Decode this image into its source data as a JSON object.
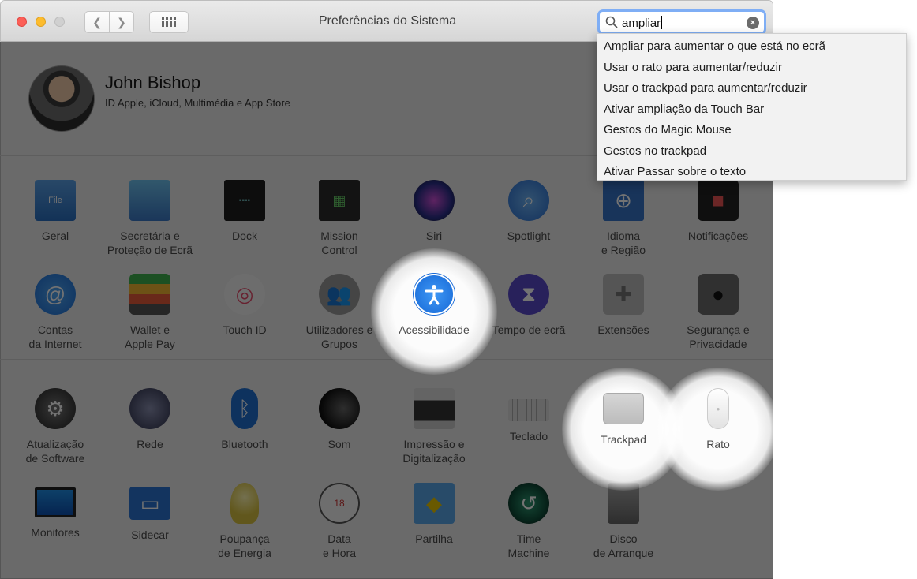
{
  "window": {
    "title": "Preferências do Sistema",
    "search": {
      "value": "ampliar"
    }
  },
  "account": {
    "name": "John Bishop",
    "subtitle": "ID Apple, iCloud, Multimédia e App Store"
  },
  "search_results": [
    "Ampliar para aumentar o que está no ecrã",
    "Usar o rato para aumentar/reduzir",
    "Usar o trackpad para aumentar/reduzir",
    "Ativar ampliação da Touch Bar",
    "Gestos do Magic Mouse",
    "Gestos no trackpad",
    "Ativar Passar sobre o texto"
  ],
  "panes": {
    "row1": [
      "Geral",
      "Secretária e\nProteção de Ecrã",
      "Dock",
      "Mission\nControl",
      "Siri",
      "Spotlight",
      "Idioma\ne Região",
      "Notificações"
    ],
    "row2": [
      "Contas\nda Internet",
      "Wallet e\nApple Pay",
      "Touch ID",
      "Utilizadores e\nGrupos",
      "Acessibilidade",
      "Tempo de ecrã",
      "Extensões",
      "Segurança e\nPrivacidade"
    ],
    "row3": [
      "Atualização\nde Software",
      "Rede",
      "Bluetooth",
      "Som",
      "Impressão e\nDigitalização",
      "Teclado",
      "Trackpad",
      "Rato"
    ],
    "row4": [
      "Monitores",
      "Sidecar",
      "Poupança\nde Energia",
      "Data\ne Hora",
      "Partilha",
      "Time\nMachine",
      "Disco\nde Arranque"
    ]
  },
  "highlighted": [
    "Acessibilidade",
    "Trackpad",
    "Rato"
  ],
  "colors": {
    "search_focus": "#7faef5",
    "accessibility_blue": "#1e7ef0"
  }
}
